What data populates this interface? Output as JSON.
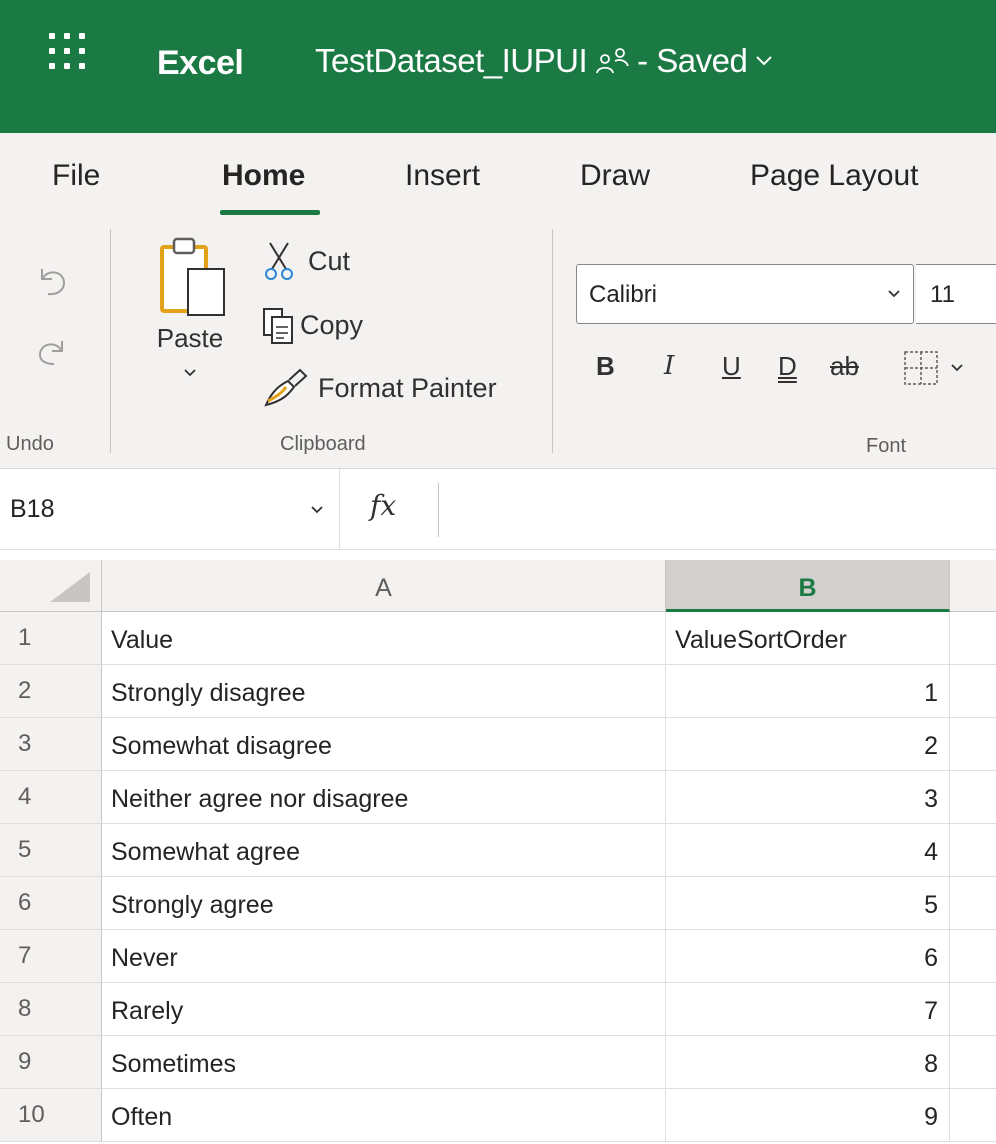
{
  "titlebar": {
    "app_name": "Excel",
    "document_name": "TestDataset_IUPUI",
    "save_status": "- Saved",
    "brand_color": "#1b7a44"
  },
  "ribbon_tabs": [
    {
      "label": "File",
      "active": false
    },
    {
      "label": "Home",
      "active": true
    },
    {
      "label": "Insert",
      "active": false
    },
    {
      "label": "Draw",
      "active": false
    },
    {
      "label": "Page Layout",
      "active": false
    }
  ],
  "ribbon": {
    "undo_group_label": "Undo",
    "clipboard_group_label": "Clipboard",
    "font_group_label": "Font",
    "paste_label": "Paste",
    "cut_label": "Cut",
    "copy_label": "Copy",
    "format_painter_label": "Format Painter",
    "font_name": "Calibri",
    "font_size": "11",
    "bold_label": "B",
    "italic_label": "I",
    "underline_label": "U",
    "double_underline_label": "D",
    "strikethrough_label": "ab"
  },
  "formula_bar": {
    "name_box": "B18",
    "fx_label": "fx",
    "formula": ""
  },
  "sheet": {
    "columns": [
      {
        "label": "A",
        "selected": false
      },
      {
        "label": "B",
        "selected": true
      }
    ],
    "rows": [
      {
        "row": "1",
        "a": "Value",
        "b": "ValueSortOrder"
      },
      {
        "row": "2",
        "a": "Strongly disagree",
        "b": "1"
      },
      {
        "row": "3",
        "a": "Somewhat disagree",
        "b": "2"
      },
      {
        "row": "4",
        "a": "Neither agree nor disagree",
        "b": "3"
      },
      {
        "row": "5",
        "a": "Somewhat agree",
        "b": "4"
      },
      {
        "row": "6",
        "a": "Strongly agree",
        "b": "5"
      },
      {
        "row": "7",
        "a": "Never",
        "b": "6"
      },
      {
        "row": "8",
        "a": "Rarely",
        "b": "7"
      },
      {
        "row": "9",
        "a": "Sometimes",
        "b": "8"
      },
      {
        "row": "10",
        "a": "Often",
        "b": "9"
      }
    ]
  }
}
